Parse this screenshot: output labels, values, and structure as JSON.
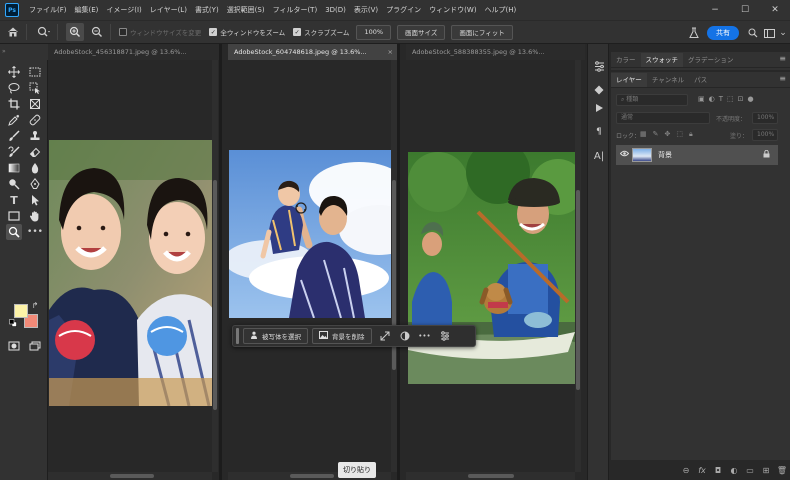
{
  "app": {
    "logo": "Ps"
  },
  "menu": [
    "ファイル(F)",
    "編集(E)",
    "イメージ(I)",
    "レイヤー(L)",
    "書式(Y)",
    "選択範囲(S)",
    "フィルター(T)",
    "3D(D)",
    "表示(V)",
    "プラグイン",
    "ウィンドウ(W)",
    "ヘルプ(H)"
  ],
  "window_controls": {
    "minimize": "−",
    "maximize": "☐",
    "close": "✕"
  },
  "options": {
    "resize_windows": "ウィンドウサイズを変更",
    "resize_windows_checked": false,
    "zoom_all": "全ウィンドウをズーム",
    "zoom_all_checked": true,
    "scrubby_zoom": "スクラブズーム",
    "scrubby_checked": true,
    "zoom_value": "100%",
    "fit_size": "画面サイズ",
    "fill_screen": "画面にフィット",
    "share": "共有"
  },
  "tabs": [
    {
      "title": "AdobeStock_456318871.jpeg @ 13.6%...",
      "active": false
    },
    {
      "title": "AdobeStock_604748618.jpeg @ 13.6%...",
      "active": true,
      "close": "×"
    },
    {
      "title": "AdobeStock_588388355.jpeg @ 13.6%...",
      "active": false
    }
  ],
  "context_bar": {
    "select_subject": "被写体を選択",
    "remove_bg": "背景を削除",
    "more": "•••"
  },
  "tooltip": "切り貼り",
  "panels": {
    "top_tabs": [
      "カラー",
      "スウォッチ",
      "グラデーション"
    ],
    "top_active": 1,
    "layer_tabs": [
      "レイヤー",
      "チャンネル",
      "パス"
    ],
    "layer_active": 0,
    "kind_label": "種類",
    "blend_mode": "通常",
    "opacity_label": "不透明度：",
    "opacity_value": "100%",
    "lock_label": "ロック：",
    "fill_label": "塗り：",
    "fill_value": "100%",
    "layer_name": "背景"
  },
  "colors": {
    "accent": "#1473e6",
    "foreground": "#fdf3a8",
    "background": "#f28a78"
  }
}
